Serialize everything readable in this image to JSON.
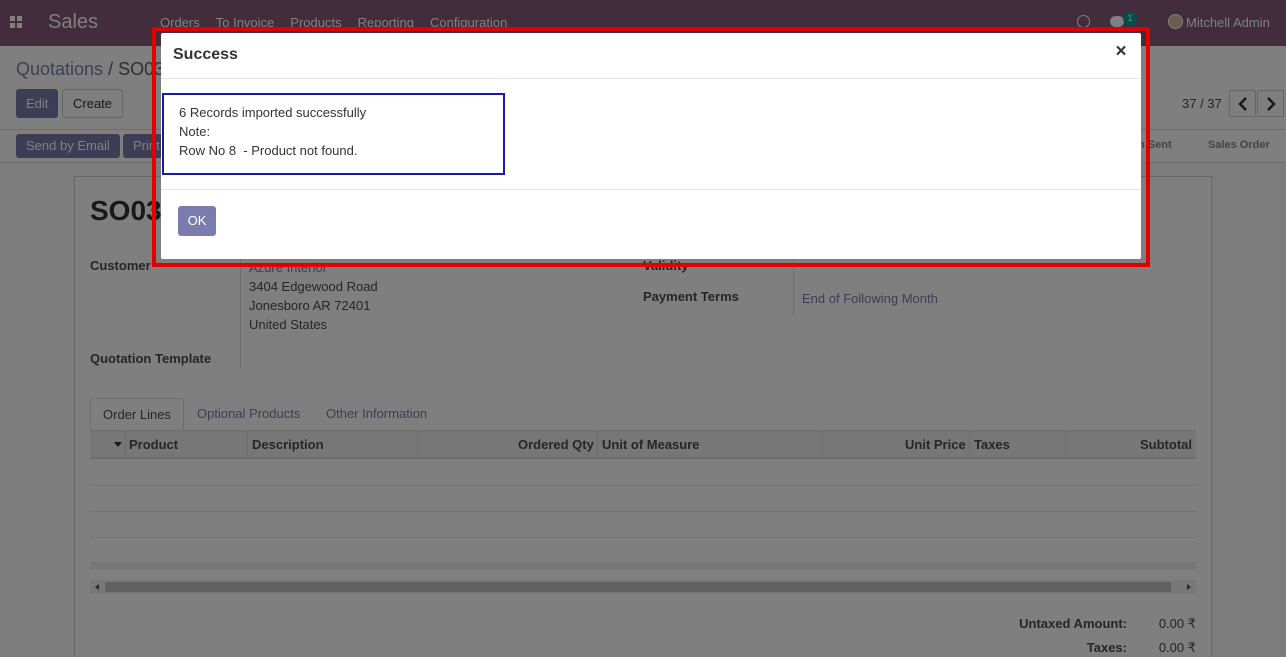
{
  "navbar": {
    "app_name": "Sales",
    "menu": [
      "Orders",
      "To Invoice",
      "Products",
      "Reporting",
      "Configuration"
    ],
    "chat_count": "1",
    "user_name": "Mitchell Admin"
  },
  "control": {
    "breadcrumb_parent": "Quotations",
    "breadcrumb_sep": "/",
    "breadcrumb_current": "SO03",
    "edit_label": "Edit",
    "create_label": "Create",
    "pager": "37 / 37"
  },
  "statusbar": {
    "send_email_label": "Send by Email",
    "print_label": "Print",
    "stage_sent": "n Sent",
    "stage_sales_order": "Sales Order"
  },
  "form": {
    "title": "SO03",
    "customer_label": "Customer",
    "customer_name": "Azure Interior",
    "address_line1": "3404 Edgewood Road",
    "address_line2": "Jonesboro AR 72401",
    "address_line3": "United States",
    "template_label": "Quotation Template",
    "validity_label": "Validity",
    "payment_terms_label": "Payment Terms",
    "payment_terms_value": "End of Following Month"
  },
  "tabs": [
    "Order Lines",
    "Optional Products",
    "Other Information"
  ],
  "table": {
    "columns": [
      "Product",
      "Description",
      "Ordered Qty",
      "Unit of Measure",
      "Unit Price",
      "Taxes",
      "Subtotal"
    ]
  },
  "totals": {
    "untaxed_label": "Untaxed Amount:",
    "untaxed_value": "0.00 ₹",
    "taxes_label": "Taxes:",
    "taxes_value": "0.00 ₹"
  },
  "dialog": {
    "title": "Success",
    "close_glyph": "×",
    "message_lines": [
      "6 Records imported successfully",
      "Note:",
      "Row No 8  - Product not found."
    ],
    "ok_label": "OK"
  },
  "colors": {
    "navbar": "#875a7b",
    "primary": "#7c7bad",
    "highlight_red": "#e00000",
    "highlight_blue": "#1a1aa8"
  }
}
